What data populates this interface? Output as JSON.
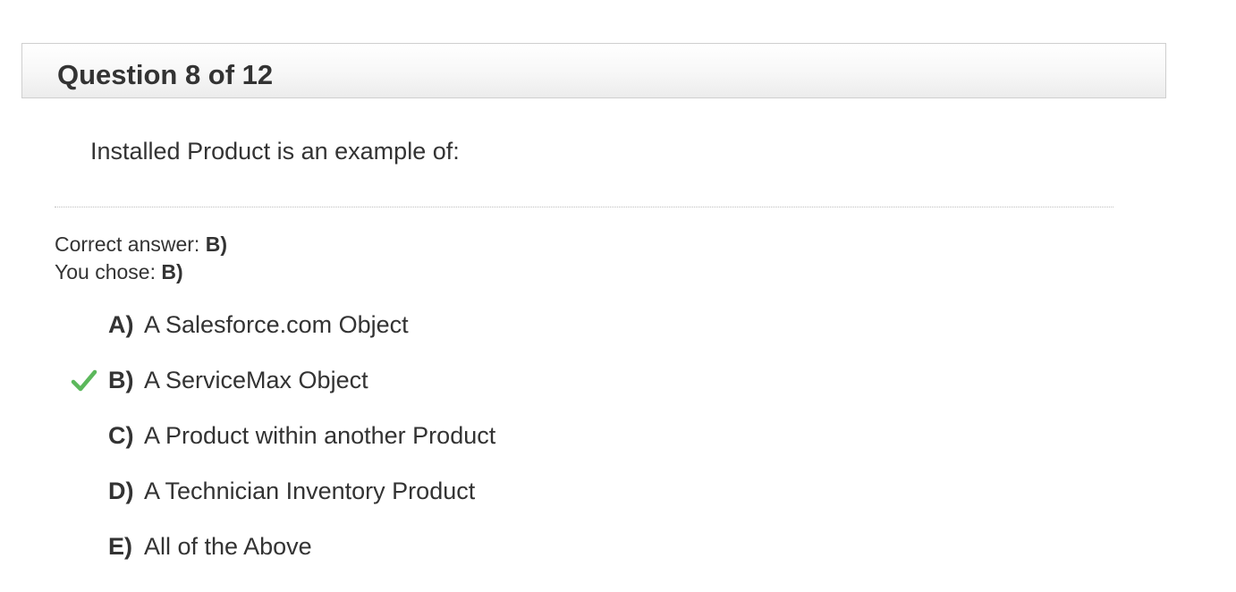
{
  "header": {
    "title": "Question 8 of 12"
  },
  "question": {
    "text": "Installed Product is an example of:"
  },
  "result": {
    "correct_label": "Correct answer:",
    "correct_value": "B)",
    "chosen_label": "You chose:",
    "chosen_value": "B)"
  },
  "options": [
    {
      "letter": "A)",
      "text": "A Salesforce.com Object",
      "selected": false
    },
    {
      "letter": "B)",
      "text": "A ServiceMax Object",
      "selected": true,
      "icon": "checkmark-icon"
    },
    {
      "letter": "C)",
      "text": "A Product within another Product",
      "selected": false
    },
    {
      "letter": "D)",
      "text": "A Technician Inventory Product",
      "selected": false
    },
    {
      "letter": "E)",
      "text": "All of the Above",
      "selected": false
    }
  ],
  "colors": {
    "text": "#333333",
    "check": "#5cb85c",
    "header_border": "#cfcfcf"
  }
}
